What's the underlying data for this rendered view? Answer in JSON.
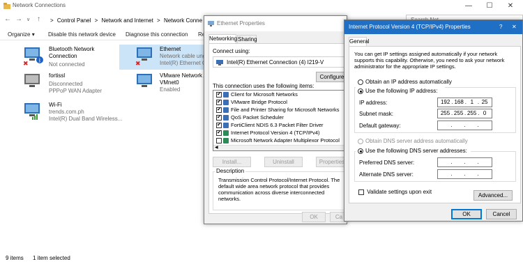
{
  "nc": {
    "title": "Network Connections",
    "breadcrumbs": [
      "Control Panel",
      "Network and Internet",
      "Network Conne"
    ],
    "search_placeholder": "Search Net",
    "sep": ">",
    "toolbar": {
      "organize": "Organize",
      "disable": "Disable this network device",
      "diagnose": "Diagnose this connection",
      "rename": "Re"
    },
    "connections": [
      {
        "name": "Bluetooth Network Connection",
        "name1": "Bluetooth Network",
        "name2": "Connection",
        "status": "Not connected",
        "icon": "bluetooth-network-icon"
      },
      {
        "name": "fortissl",
        "status": "Disconnected",
        "detail": "PPPoP WAN Adapter",
        "icon": "network-adapter-icon"
      },
      {
        "name": "Wi-Fi",
        "status": "trends.com.ph",
        "detail": "Intel(R) Dual Band Wireless...",
        "icon": "wifi-icon"
      },
      {
        "name": "Ethernet",
        "status": "Network cable ung",
        "detail": "Intel(R) Ethernet C",
        "icon": "ethernet-icon"
      },
      {
        "name": "VMware Network A",
        "status": "VMnet0",
        "detail": "Enabled",
        "icon": "network-adapter-icon"
      }
    ],
    "status_items": "9 items",
    "status_selected": "1 item selected"
  },
  "eth": {
    "title": "Ethernet Properties",
    "tabs": [
      "Networking",
      "Sharing"
    ],
    "connect_using_label": "Connect using:",
    "adapter": "Intel(R) Ethernet Connection (4) I219-V",
    "configure": "Configure",
    "items_label": "This connection uses the following items:",
    "items": [
      {
        "label": "Client for Microsoft Networks",
        "checked": true,
        "color": "#3b6fb6"
      },
      {
        "label": "VMware Bridge Protocol",
        "checked": true,
        "color": "#3b6fb6"
      },
      {
        "label": "File and Printer Sharing for Microsoft Networks",
        "checked": true,
        "color": "#3b6fb6"
      },
      {
        "label": "QoS Packet Scheduler",
        "checked": true,
        "color": "#3b6fb6"
      },
      {
        "label": "FortiClient NDIS 6.3 Packet Filter Driver",
        "checked": true,
        "color": "#3b6fb6"
      },
      {
        "label": "Internet Protocol Version 4 (TCP/IPv4)",
        "checked": true,
        "color": "#2e8b57"
      },
      {
        "label": "Microsoft Network Adapter Multiplexor Protocol",
        "checked": false,
        "color": "#2e8b57"
      }
    ],
    "install": "Install...",
    "uninstall": "Uninstall",
    "properties": "Properties",
    "description_label": "Description",
    "description": "Transmission Control Protocol/Internet Protocol. The default wide area network protocol that provides communication across diverse interconnected networks.",
    "ok": "OK",
    "cancel": "Ca"
  },
  "ipv4": {
    "title": "Internet Protocol Version 4 (TCP/IPv4) Properties",
    "tab": "General",
    "intro": "You can get IP settings assigned automatically if your network supports this capability. Otherwise, you need to ask your network administrator for the appropriate IP settings.",
    "obtain_ip": "Obtain an IP address automatically",
    "use_ip": "Use the following IP address:",
    "ip_label": "IP address:",
    "ip": [
      "192",
      "168",
      "1",
      "25"
    ],
    "mask_label": "Subnet mask:",
    "mask": [
      "255",
      "255",
      "255",
      "0"
    ],
    "gw_label": "Default gateway:",
    "obtain_dns": "Obtain DNS server address automatically",
    "use_dns": "Use the following DNS server addresses:",
    "pref_dns_label": "Preferred DNS server:",
    "alt_dns_label": "Alternate DNS server:",
    "validate": "Validate settings upon exit",
    "advanced": "Advanced...",
    "ok": "OK",
    "cancel": "Cancel",
    "help": "?",
    "close": "✕"
  },
  "colors": {
    "accent": "#0078d7",
    "selection": "#cce4f7"
  }
}
